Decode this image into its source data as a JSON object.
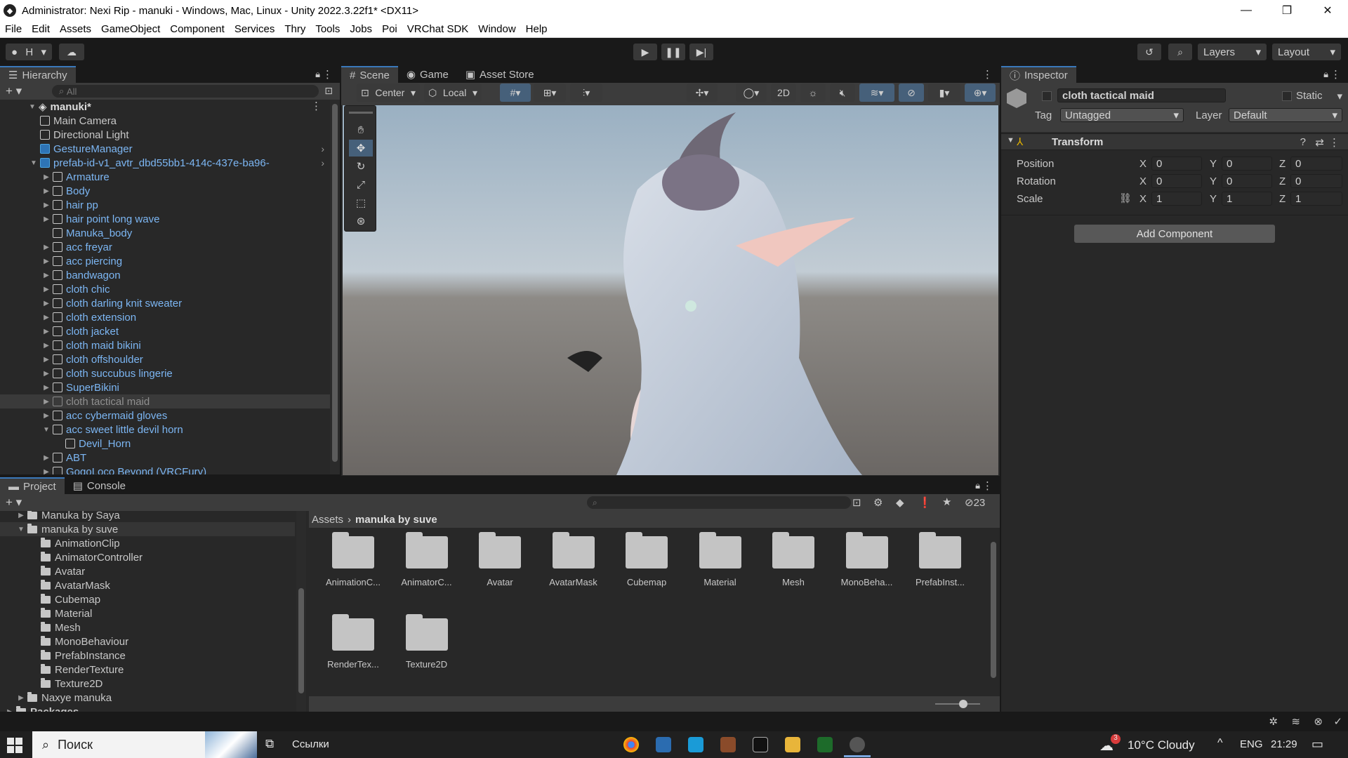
{
  "window": {
    "title": "Administrator: Nexi Rip - manuki - Windows, Mac, Linux - Unity 2022.3.22f1* <DX11>"
  },
  "menu": [
    "File",
    "Edit",
    "Assets",
    "GameObject",
    "Component",
    "Services",
    "Thry",
    "Tools",
    "Jobs",
    "Poi",
    "VRChat SDK",
    "Window",
    "Help"
  ],
  "toolbar": {
    "account": "H",
    "layers": "Layers",
    "layout": "Layout"
  },
  "hierarchy": {
    "tab": "Hierarchy",
    "search_placeholder": "All",
    "scene": "manuki*",
    "items": [
      {
        "label": "Main Camera",
        "depth": 1,
        "style": "white"
      },
      {
        "label": "Directional Light",
        "depth": 1,
        "style": "white"
      },
      {
        "label": "GestureManager",
        "depth": 1,
        "style": "blue"
      },
      {
        "label": "prefab-id-v1_avtr_dbd55bb1-414c-437e-ba96-",
        "depth": 1,
        "style": "blue"
      },
      {
        "label": "Armature",
        "depth": 2,
        "style": "blue"
      },
      {
        "label": "Body",
        "depth": 2,
        "style": "blue"
      },
      {
        "label": "hair pp",
        "depth": 2,
        "style": "blue"
      },
      {
        "label": "hair point long wave",
        "depth": 2,
        "style": "blue"
      },
      {
        "label": "Manuka_body",
        "depth": 2,
        "style": "blue"
      },
      {
        "label": "acc freyar",
        "depth": 2,
        "style": "blue"
      },
      {
        "label": "acc piercing",
        "depth": 2,
        "style": "blue"
      },
      {
        "label": "bandwagon",
        "depth": 2,
        "style": "blue"
      },
      {
        "label": "cloth chic",
        "depth": 2,
        "style": "blue"
      },
      {
        "label": "cloth darling knit sweater",
        "depth": 2,
        "style": "blue"
      },
      {
        "label": "cloth extension",
        "depth": 2,
        "style": "blue"
      },
      {
        "label": "cloth jacket",
        "depth": 2,
        "style": "blue"
      },
      {
        "label": "cloth maid bikini",
        "depth": 2,
        "style": "blue"
      },
      {
        "label": "cloth offshoulder",
        "depth": 2,
        "style": "blue"
      },
      {
        "label": "cloth succubus lingerie",
        "depth": 2,
        "style": "blue"
      },
      {
        "label": "SuperBikini",
        "depth": 2,
        "style": "blue"
      },
      {
        "label": "cloth tactical maid",
        "depth": 2,
        "style": "grey"
      },
      {
        "label": "acc cybermaid gloves",
        "depth": 2,
        "style": "blue"
      },
      {
        "label": "acc sweet little devil horn",
        "depth": 2,
        "style": "blue"
      },
      {
        "label": "Devil_Horn",
        "depth": 3,
        "style": "blue"
      },
      {
        "label": "ABT",
        "depth": 2,
        "style": "blue"
      },
      {
        "label": "GogoLoco Beyond (VRCFury)",
        "depth": 2,
        "style": "blue"
      }
    ]
  },
  "scene_tabs": [
    "Scene",
    "Game",
    "Asset Store"
  ],
  "scene_toolbar": {
    "pivot": "Center",
    "space": "Local",
    "mode2d": "2D"
  },
  "inspector": {
    "tab": "Inspector",
    "object_name": "cloth tactical maid",
    "static_label": "Static",
    "tag_label": "Tag",
    "tag_value": "Untagged",
    "layer_label": "Layer",
    "layer_value": "Default",
    "component": "Transform",
    "rows": [
      {
        "label": "Position",
        "x": "0",
        "y": "0",
        "z": "0"
      },
      {
        "label": "Rotation",
        "x": "0",
        "y": "0",
        "z": "0"
      },
      {
        "label": "Scale",
        "x": "1",
        "y": "1",
        "z": "1"
      }
    ],
    "axes": [
      "X",
      "Y",
      "Z"
    ],
    "add_component": "Add Component"
  },
  "project": {
    "tabs": [
      "Project",
      "Console"
    ],
    "hidden_count": "23",
    "breadcrumb": [
      "Assets",
      "manuka by suve"
    ],
    "tree": [
      {
        "label": "Manuka by Saya",
        "depth": 1
      },
      {
        "label": "manuka by suve",
        "depth": 1
      },
      {
        "label": "AnimationClip",
        "depth": 2
      },
      {
        "label": "AnimatorController",
        "depth": 2
      },
      {
        "label": "Avatar",
        "depth": 2
      },
      {
        "label": "AvatarMask",
        "depth": 2
      },
      {
        "label": "Cubemap",
        "depth": 2
      },
      {
        "label": "Material",
        "depth": 2
      },
      {
        "label": "Mesh",
        "depth": 2
      },
      {
        "label": "MonoBehaviour",
        "depth": 2
      },
      {
        "label": "PrefabInstance",
        "depth": 2
      },
      {
        "label": "RenderTexture",
        "depth": 2
      },
      {
        "label": "Texture2D",
        "depth": 2
      },
      {
        "label": "Naxye manuka",
        "depth": 1
      },
      {
        "label": "Packages",
        "depth": 0
      }
    ],
    "assets": [
      "AnimationC...",
      "AnimatorC...",
      "Avatar",
      "AvatarMask",
      "Cubemap",
      "Material",
      "Mesh",
      "MonoBeha...",
      "PrefabInst...",
      "RenderTex...",
      "Texture2D"
    ]
  },
  "taskbar": {
    "search": "Поиск",
    "links": "Ссылки",
    "weather": "10°C  Cloudy",
    "weather_badge": "3",
    "lang": "ENG",
    "time": "21:29"
  }
}
